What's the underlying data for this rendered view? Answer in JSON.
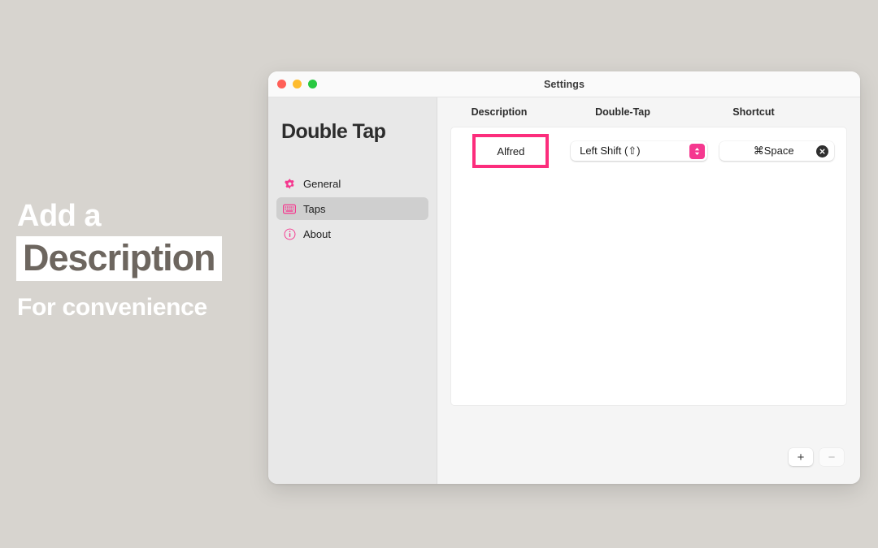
{
  "promo": {
    "line1": "Add a",
    "line2": "Description",
    "line3": "For convenience",
    "highlight_color": "#ffffff",
    "text_color": "#6d665f"
  },
  "window": {
    "title": "Settings",
    "traffic_lights": [
      "close-red",
      "minimize-yellow",
      "zoom-green"
    ]
  },
  "sidebar": {
    "app_title": "Double Tap",
    "items": [
      {
        "label": "General",
        "icon": "gear-icon",
        "selected": false
      },
      {
        "label": "Taps",
        "icon": "keyboard-icon",
        "selected": true
      },
      {
        "label": "About",
        "icon": "info-circle-icon",
        "selected": false
      }
    ]
  },
  "main": {
    "columns": [
      "Description",
      "Double-Tap",
      "Shortcut"
    ],
    "rows": [
      {
        "description": "Alfred",
        "double_tap": "Left Shift (⇧)",
        "shortcut": "⌘Space"
      }
    ],
    "footer": {
      "add_label": "+",
      "remove_label": "−"
    }
  },
  "colors": {
    "accent_pink": "#f5388f",
    "highlight_border": "#fc2d7c",
    "page_background": "#d7d4cf"
  }
}
